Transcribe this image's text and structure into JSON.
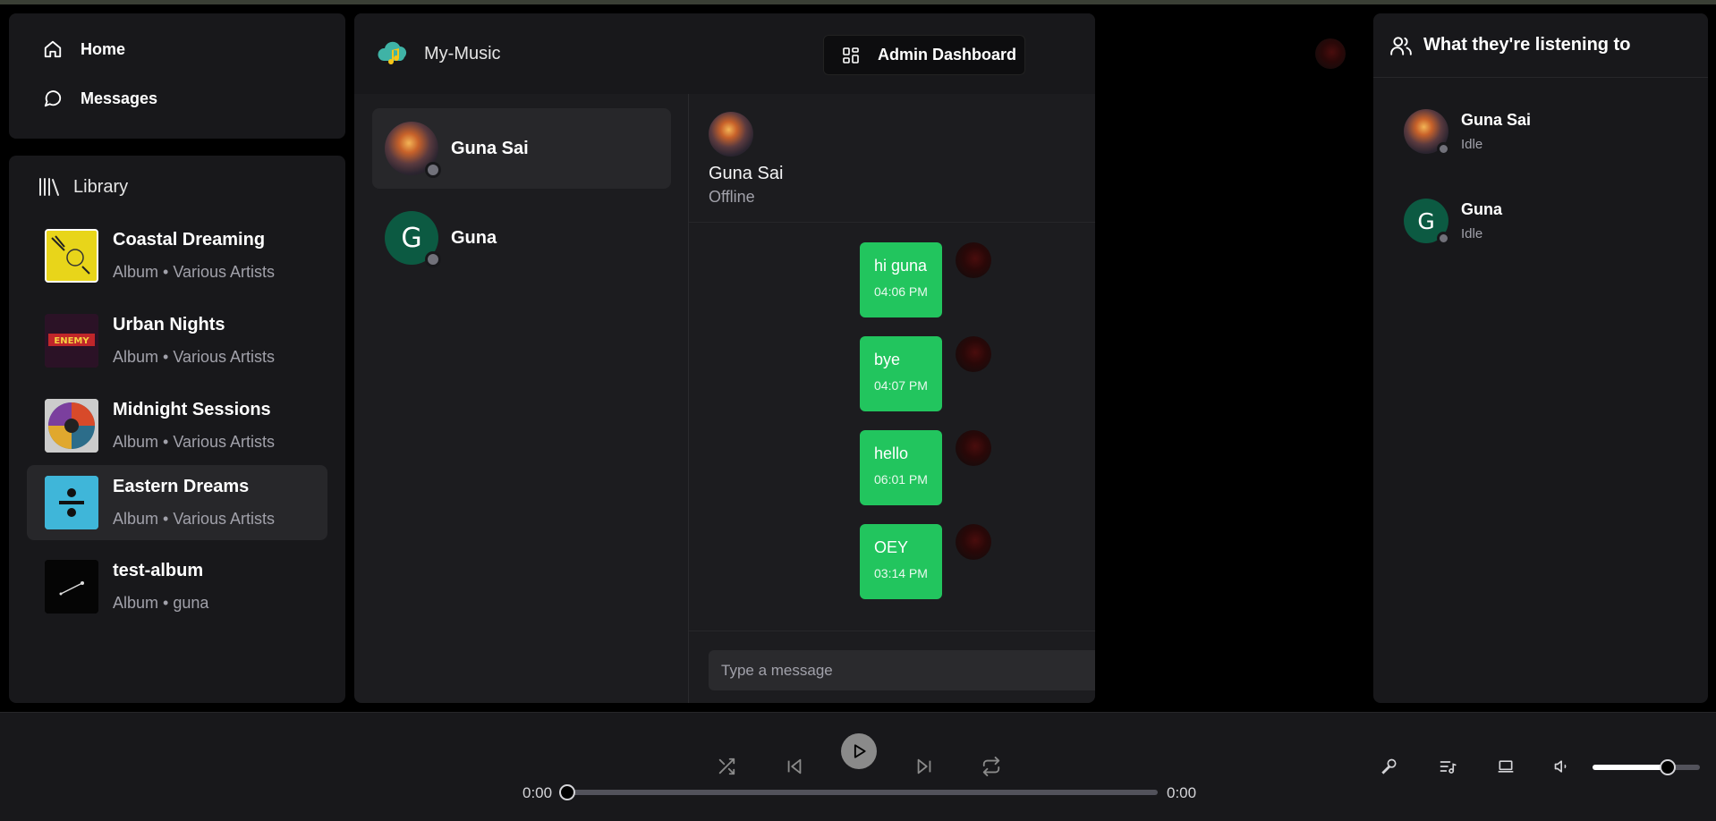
{
  "nav": {
    "home": "Home",
    "messages": "Messages"
  },
  "library": {
    "title": "Library",
    "albums": [
      {
        "title": "Coastal Dreaming",
        "subtitle": "Album • Various Artists",
        "art_color": "#e8d51a"
      },
      {
        "title": "Urban Nights",
        "subtitle": "Album • Various Artists",
        "art_color": "#3a1530"
      },
      {
        "title": "Midnight Sessions",
        "subtitle": "Album • Various Artists",
        "art_color": "#7a5a9a"
      },
      {
        "title": "Eastern Dreams",
        "subtitle": "Album • Various Artists",
        "art_color": "#3fb6d9"
      },
      {
        "title": "test-album",
        "subtitle": "Album • guna",
        "art_color": "#050505"
      }
    ]
  },
  "header": {
    "app_name": "My-Music",
    "admin_button": "Admin Dashboard"
  },
  "conversations": [
    {
      "name": "Guna Sai",
      "avatar": "photo"
    },
    {
      "name": "Guna",
      "avatar_letter": "G"
    }
  ],
  "chat": {
    "name": "Guna Sai",
    "status": "Offline",
    "messages": [
      {
        "text": "hi guna",
        "time": "04:06 PM"
      },
      {
        "text": "bye",
        "time": "04:07 PM"
      },
      {
        "text": "hello",
        "time": "06:01 PM"
      },
      {
        "text": "OEY",
        "time": "03:14 PM"
      }
    ],
    "input_placeholder": "Type a message"
  },
  "activity": {
    "title": "What they're listening to",
    "friends": [
      {
        "name": "Guna Sai",
        "status": "Idle"
      },
      {
        "name": "Guna",
        "status": "Idle",
        "avatar_letter": "G"
      }
    ]
  },
  "player": {
    "current_time": "0:00",
    "duration": "0:00",
    "progress": 0,
    "volume": 0.7
  },
  "colors": {
    "accent": "#22c55e",
    "panel": "#18181b",
    "avatar_green": "#0c5a42"
  }
}
